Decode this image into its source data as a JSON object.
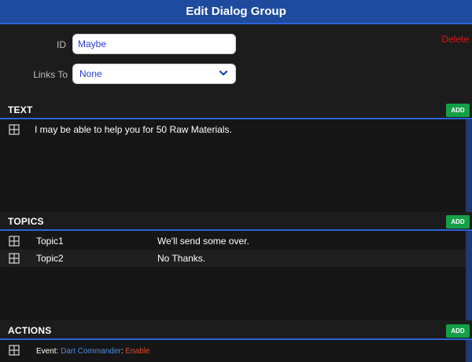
{
  "dialog": {
    "title": "Edit Dialog Group"
  },
  "form": {
    "id_label": "ID",
    "id_value": "Maybe",
    "links_label": "Links To",
    "links_value": "None",
    "delete_label": "Delete"
  },
  "sections": {
    "text": {
      "title": "TEXT",
      "add_label": "ADD",
      "items": [
        {
          "text": "I may be able to help you for 50 Raw Materials."
        }
      ]
    },
    "topics": {
      "title": "TOPICS",
      "add_label": "ADD",
      "items": [
        {
          "name": "Topic1",
          "reply": "We'll send some over."
        },
        {
          "name": "Topic2",
          "reply": "No Thanks."
        }
      ]
    },
    "actions": {
      "title": "ACTIONS",
      "add_label": "ADD",
      "items": [
        {
          "type": "Event",
          "target": "Dart Commander",
          "value": "Enable"
        }
      ]
    }
  },
  "colors": {
    "title_bar": "#1f4b9e",
    "accent": "#2a63d6",
    "add_button": "#14a046",
    "delete": "#e01414",
    "event_target": "#4d8ce6",
    "event_value": "#e04a2a"
  },
  "icons": {
    "drag_handle": "grid-drag-icon",
    "dropdown": "chevron-down-icon"
  }
}
